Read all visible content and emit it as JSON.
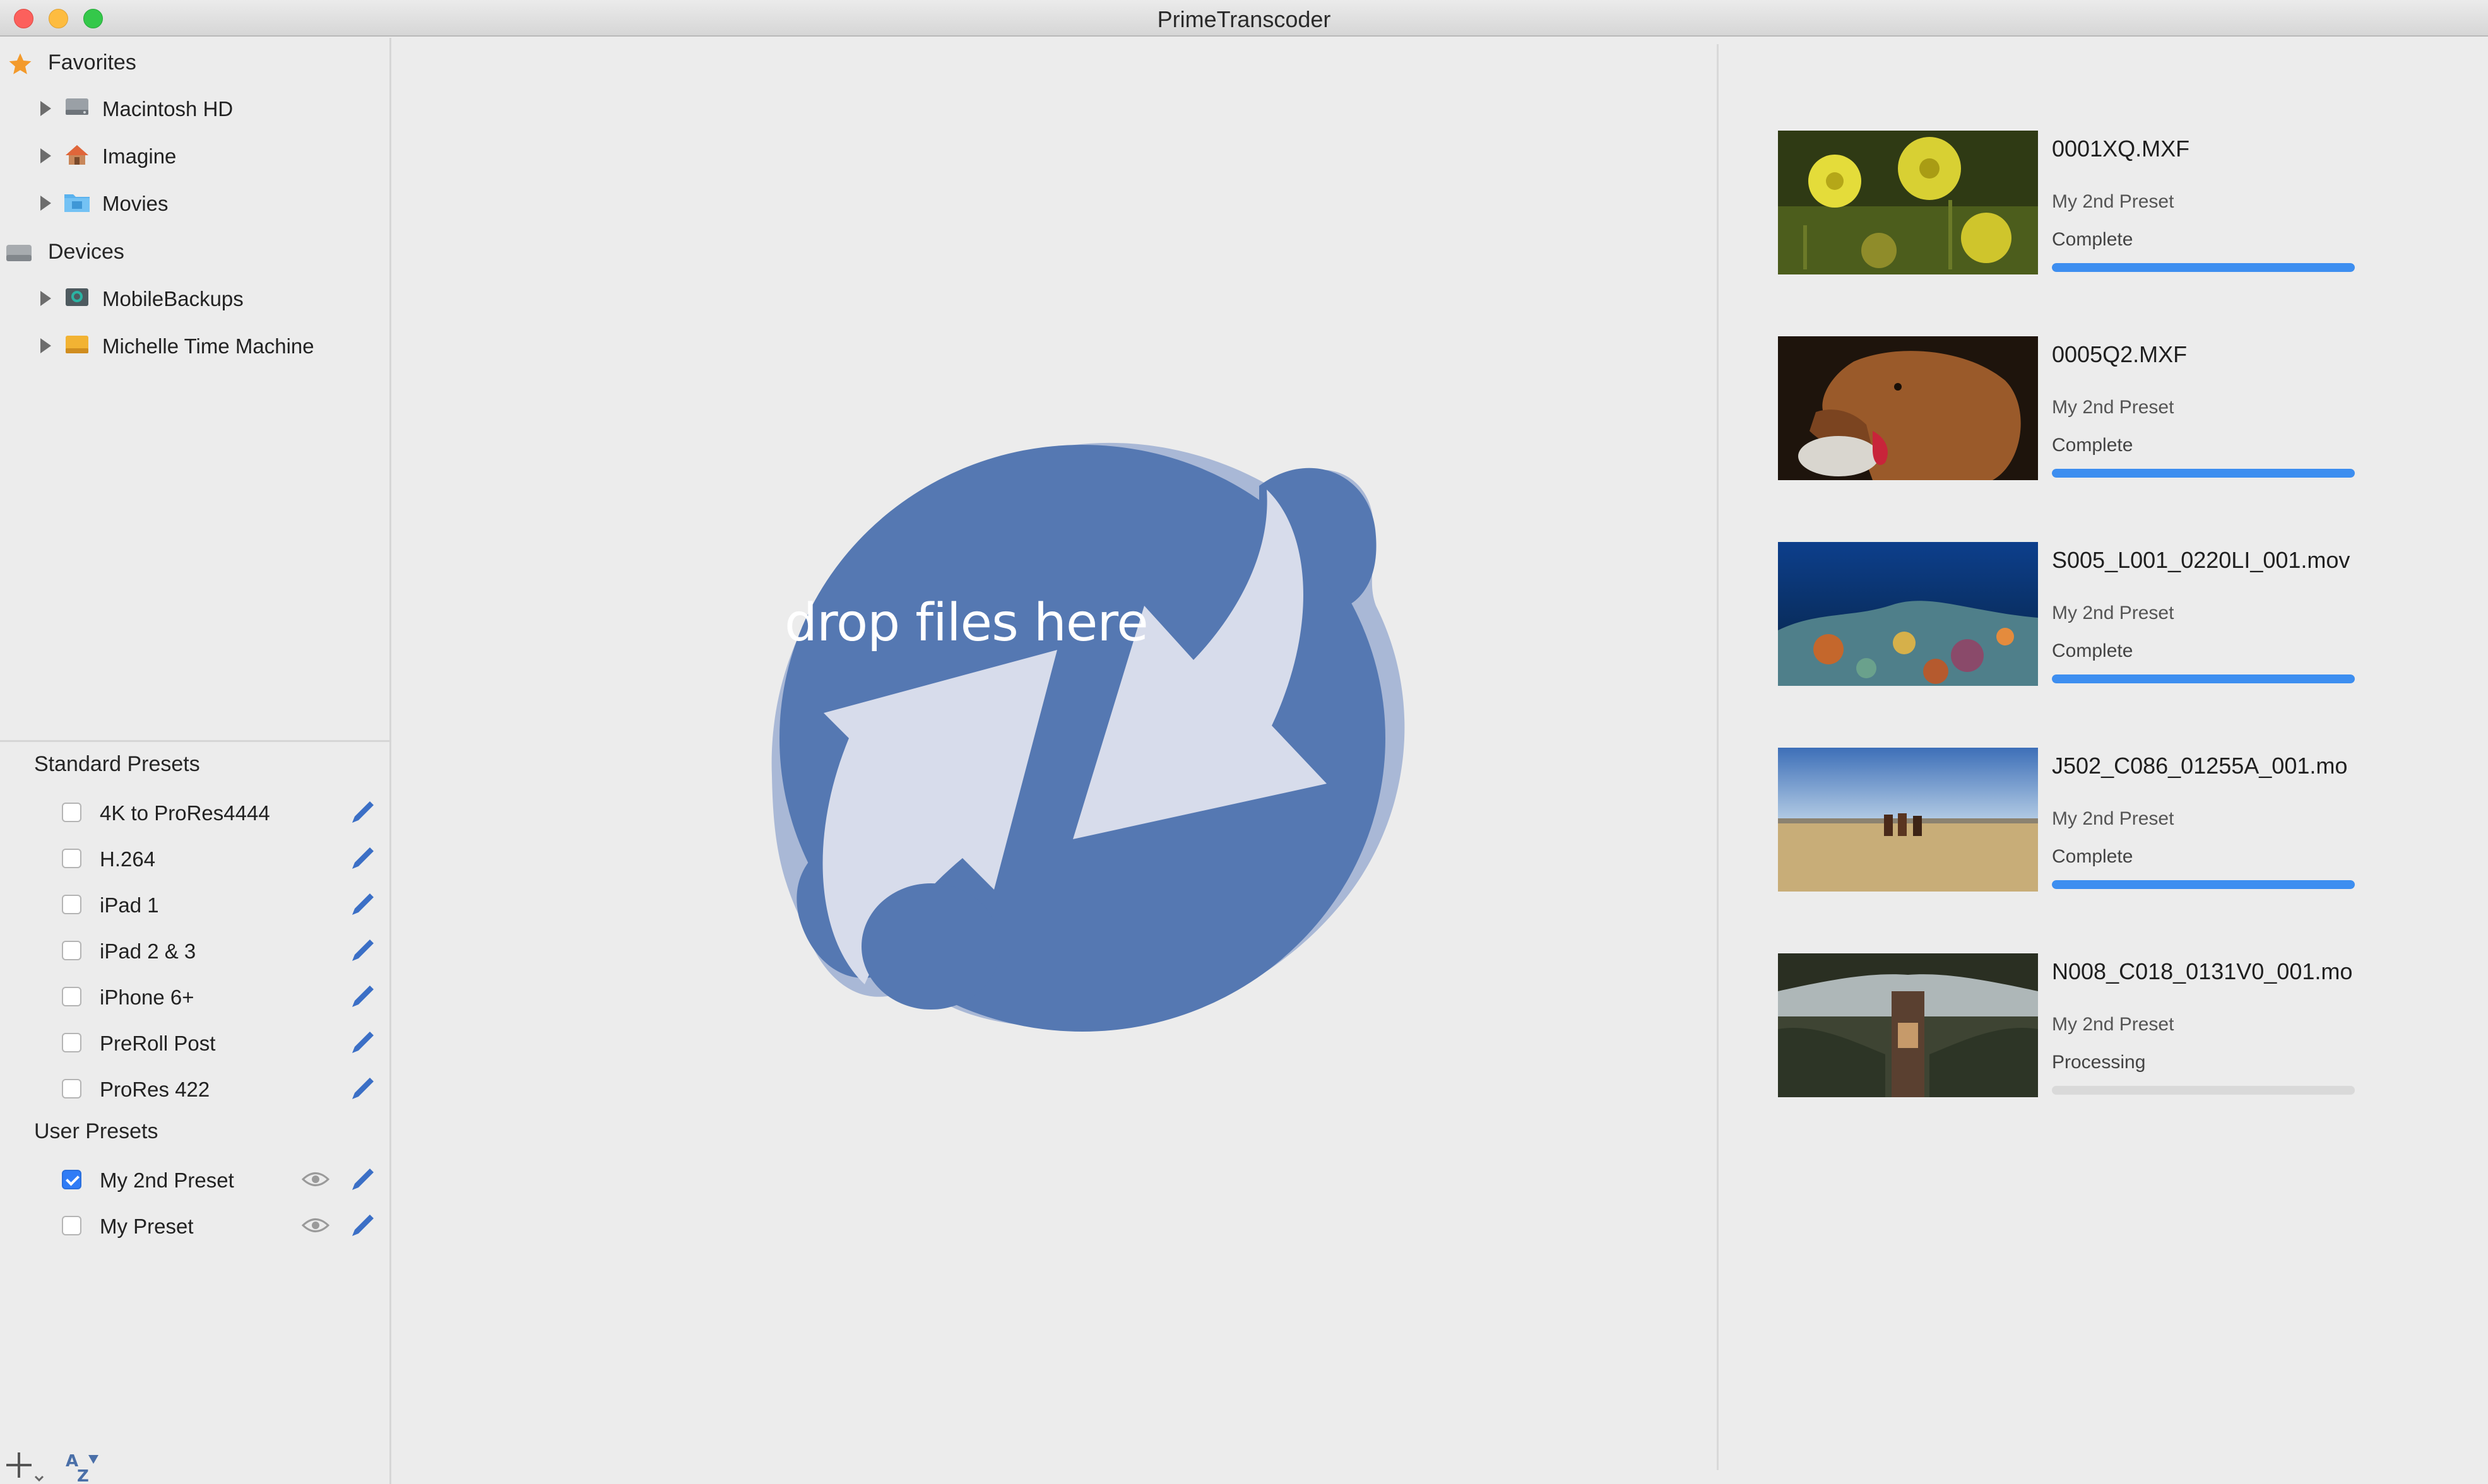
{
  "window": {
    "title": "PrimeTranscoder"
  },
  "sidebar": {
    "favorites": {
      "label": "Favorites",
      "icon": "star-icon",
      "items": [
        {
          "label": "Macintosh HD",
          "icon": "hard-drive-icon"
        },
        {
          "label": "Imagine",
          "icon": "home-icon"
        },
        {
          "label": "Movies",
          "icon": "folder-icon"
        }
      ]
    },
    "devices": {
      "label": "Devices",
      "icon": "disk-icon",
      "items": [
        {
          "label": "MobileBackups",
          "icon": "time-machine-drive-icon"
        },
        {
          "label": "Michelle Time Machine",
          "icon": "external-drive-icon"
        }
      ]
    },
    "standard_presets": {
      "label": "Standard Presets",
      "items": [
        {
          "label": "4K to ProRes4444",
          "checked": false
        },
        {
          "label": "H.264",
          "checked": false
        },
        {
          "label": "iPad 1",
          "checked": false
        },
        {
          "label": "iPad 2 & 3",
          "checked": false
        },
        {
          "label": "iPhone 6+",
          "checked": false
        },
        {
          "label": "PreRoll Post",
          "checked": false
        },
        {
          "label": "ProRes 422",
          "checked": false
        }
      ]
    },
    "user_presets": {
      "label": "User Presets",
      "items": [
        {
          "label": "My 2nd Preset",
          "checked": true
        },
        {
          "label": "My Preset",
          "checked": false
        }
      ]
    }
  },
  "drop_zone": {
    "text": "drop files here",
    "color": "#5578b2"
  },
  "queue": [
    {
      "name": "0001XQ.MXF",
      "preset": "My 2nd Preset",
      "status": "Complete",
      "progress": 1.0,
      "thumb": "flowers"
    },
    {
      "name": "0005Q2.MXF",
      "preset": "My 2nd Preset",
      "status": "Complete",
      "progress": 1.0,
      "thumb": "dog"
    },
    {
      "name": "S005_L001_0220LI_001.mov",
      "preset": "My 2nd Preset",
      "status": "Complete",
      "progress": 1.0,
      "thumb": "reef"
    },
    {
      "name": "J502_C086_01255A_001.mo",
      "preset": "My 2nd Preset",
      "status": "Complete",
      "progress": 1.0,
      "thumb": "desert"
    },
    {
      "name": "N008_C018_0131V0_001.mo",
      "preset": "My 2nd Preset",
      "status": "Processing",
      "progress": 0.0,
      "thumb": "tree"
    }
  ],
  "colors": {
    "accent": "#3d8ef0",
    "pencil": "#3b6fc6"
  }
}
